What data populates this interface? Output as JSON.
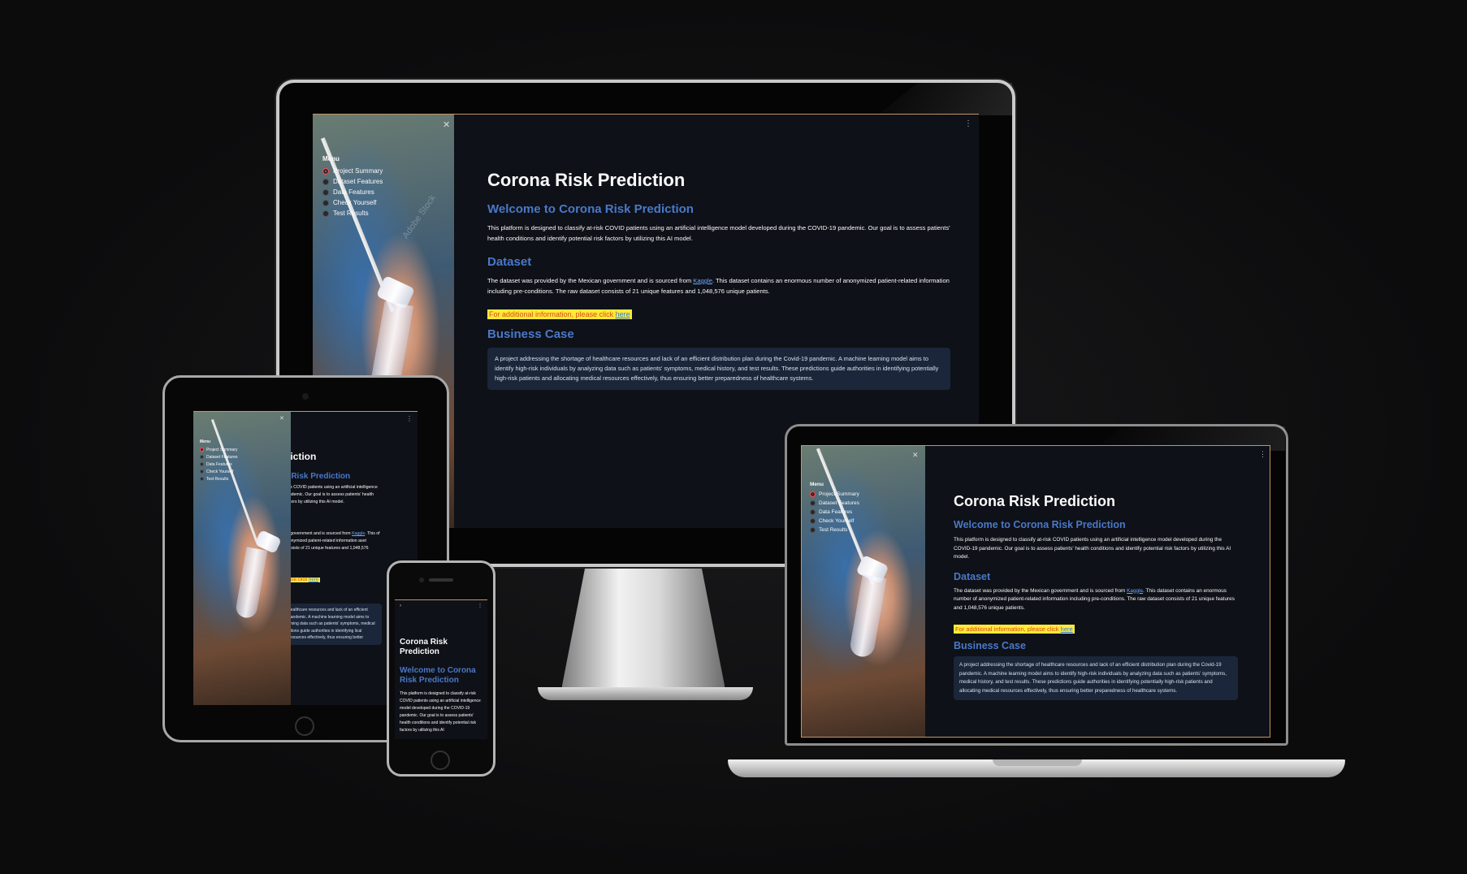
{
  "app": {
    "title": "Corona Risk Prediction",
    "close_icon": "close-icon",
    "kebab_icon": "kebab-menu-icon",
    "expand_icon": "chevron-right-icon"
  },
  "sidebar": {
    "menu_label": "Menu",
    "items": [
      {
        "label": "Project Summary",
        "selected": true
      },
      {
        "label": "Dataset Features",
        "selected": false
      },
      {
        "label": "Data Features",
        "selected": false
      },
      {
        "label": "Check Yourself",
        "selected": false
      },
      {
        "label": "Test Results",
        "selected": false
      }
    ],
    "watermark": "Adobe Stock"
  },
  "content": {
    "welcome_heading": "Welcome to Corona Risk Prediction",
    "intro": "This platform is designed to classify at-risk COVID patients using an artificial intelligence model developed during the COVID-19 pandemic. Our goal is to assess patients' health conditions and identify potential risk factors by utilizing this AI model.",
    "dataset_heading": "Dataset",
    "dataset_pre": "The dataset was provided by the Mexican government and is sourced from ",
    "dataset_link": "Kaggle",
    "dataset_post": ". This dataset contains an enormous number of anonymized patient-related information including pre-conditions. The raw dataset consists of 21 unique features and 1,048,576 unique patients.",
    "additional_pre": "For additional information, please click ",
    "additional_link": "here",
    "business_heading": "Business Case",
    "business_text": "A project addressing the shortage of healthcare resources and lack of an efficient distribution plan during the Covid-19 pandemic. A machine learning model aims to identify high-risk individuals by analyzing data such as patients' symptoms, medical history, and test results. These predictions guide authorities in identifying potentially high-risk patients and allocating medical resources effectively, thus ensuring better preparedness of healthcare systems."
  },
  "tablet": {
    "title_fragment": "diction",
    "welcome_fragment": "a Risk Prediction",
    "intro_fragment": "-risk COVID patients using an artificial intelligence pandemic. Our goal is to assess patients' health factors by utilizing this AI model.",
    "dataset_fragment": "an government and is sourced from",
    "dataset_post_fragment": ". This of anonymized patient-related information aset consists of 21 unique features and 1,048,576",
    "additional_fragment": "ease click ",
    "business_fragment": "healthcare resources and lack of an efficient pandemic. A machine learning model aims to lysing data such as patients' symptoms, medical ctions guide authorities in identifying lical resources effectively, thus ensuring better"
  },
  "phone": {
    "title": "Corona Risk Prediction",
    "welcome_heading": "Welcome to Corona Risk Prediction",
    "intro": "This platform is designed to classify at-risk COVID patients using an artificial intelligence model developed during the COVID-19 pandemic. Our goal is to assess patients' health conditions and identify potential risk factors by utilizing this AI"
  },
  "colors": {
    "app_bg": "#0e1117",
    "heading_blue": "#4a78c9",
    "highlight": "#ffea35",
    "radio_selected": "#ff4b4b",
    "box_bg": "#1b263a"
  }
}
